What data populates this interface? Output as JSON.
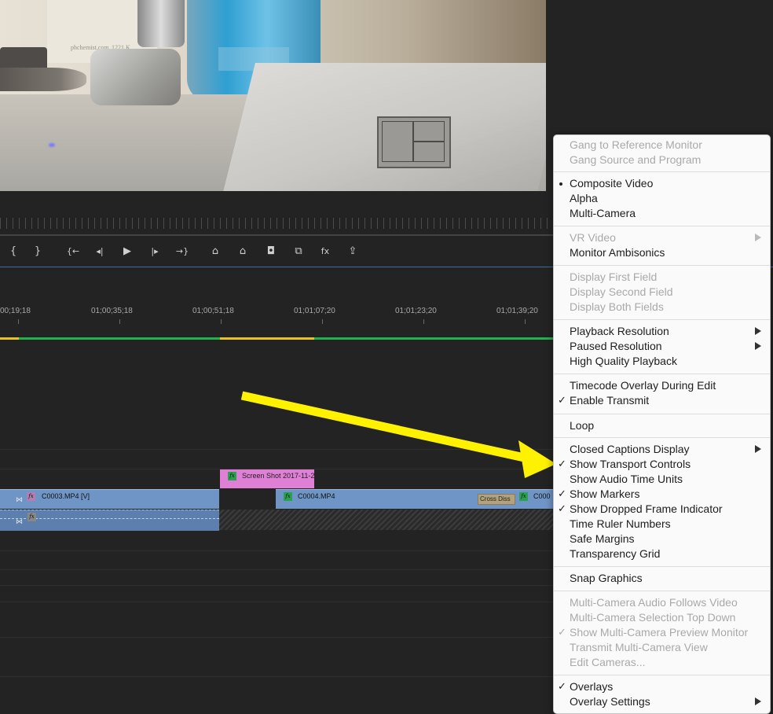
{
  "program_monitor": {
    "card_text_1": "phchemist.com",
    "card_text_2": "1221 K"
  },
  "transport": {
    "buttons": [
      {
        "name": "mark-in-icon",
        "glyph": "{"
      },
      {
        "name": "mark-out-icon",
        "glyph": "}"
      },
      {
        "name": "go-to-in-icon",
        "glyph": "{←"
      },
      {
        "name": "step-back-icon",
        "glyph": "◂|"
      },
      {
        "name": "play-icon",
        "glyph": "▶"
      },
      {
        "name": "step-forward-icon",
        "glyph": "|▸"
      },
      {
        "name": "go-to-out-icon",
        "glyph": "→}"
      },
      {
        "name": "lift-icon",
        "glyph": "⌂"
      },
      {
        "name": "extract-icon",
        "glyph": "⌂"
      },
      {
        "name": "export-frame-icon",
        "glyph": "◘"
      },
      {
        "name": "comparison-view-icon",
        "glyph": "⧉"
      },
      {
        "name": "fx-icon",
        "glyph": "fx"
      },
      {
        "name": "export-icon",
        "glyph": "⇪"
      }
    ]
  },
  "timeline": {
    "timecodes": [
      "00;19;18",
      "01;00;35;18",
      "01;00;51;18",
      "01;01;07;20",
      "01;01;23;20",
      "01;01;39;20"
    ],
    "clips": {
      "v1_clip_a": "C0003.MP4 [V]",
      "v1_clip_b": "C0004.MP4",
      "v1_clip_c": "C000",
      "v2_graphic": "Screen Shot 2017-11-2",
      "transition": "Cross Diss"
    }
  },
  "menu": {
    "groups": [
      [
        {
          "label": "Gang to Reference Monitor",
          "enabled": false
        },
        {
          "label": "Gang Source and Program",
          "enabled": false
        }
      ],
      [
        {
          "label": "Composite Video",
          "enabled": true,
          "mark": "bullet"
        },
        {
          "label": "Alpha",
          "enabled": true
        },
        {
          "label": "Multi-Camera",
          "enabled": true
        }
      ],
      [
        {
          "label": "VR Video",
          "enabled": false,
          "submenu": true
        },
        {
          "label": "Monitor Ambisonics",
          "enabled": true
        }
      ],
      [
        {
          "label": "Display First Field",
          "enabled": false
        },
        {
          "label": "Display Second Field",
          "enabled": false
        },
        {
          "label": "Display Both Fields",
          "enabled": false
        }
      ],
      [
        {
          "label": "Playback Resolution",
          "enabled": true,
          "submenu": true
        },
        {
          "label": "Paused Resolution",
          "enabled": true,
          "submenu": true
        },
        {
          "label": "High Quality Playback",
          "enabled": true
        }
      ],
      [
        {
          "label": "Timecode Overlay During Edit",
          "enabled": true
        },
        {
          "label": "Enable Transmit",
          "enabled": true,
          "mark": "check"
        }
      ],
      [
        {
          "label": "Loop",
          "enabled": true
        }
      ],
      [
        {
          "label": "Closed Captions Display",
          "enabled": true,
          "submenu": true
        },
        {
          "label": "Show Transport Controls",
          "enabled": true,
          "mark": "check"
        },
        {
          "label": "Show Audio Time Units",
          "enabled": true
        },
        {
          "label": "Show Markers",
          "enabled": true,
          "mark": "check"
        },
        {
          "label": "Show Dropped Frame Indicator",
          "enabled": true,
          "mark": "check"
        },
        {
          "label": "Time Ruler Numbers",
          "enabled": true
        },
        {
          "label": "Safe Margins",
          "enabled": true
        },
        {
          "label": "Transparency Grid",
          "enabled": true
        }
      ],
      [
        {
          "label": "Snap Graphics",
          "enabled": true
        }
      ],
      [
        {
          "label": "Multi-Camera Audio Follows Video",
          "enabled": false
        },
        {
          "label": "Multi-Camera Selection Top Down",
          "enabled": false
        },
        {
          "label": "Show Multi-Camera Preview Monitor",
          "enabled": false,
          "mark": "check"
        },
        {
          "label": "Transmit Multi-Camera View",
          "enabled": false
        },
        {
          "label": "Edit Cameras...",
          "enabled": false
        }
      ],
      [
        {
          "label": "Overlays",
          "enabled": true,
          "mark": "check"
        },
        {
          "label": "Overlay Settings",
          "enabled": true,
          "submenu": true
        }
      ]
    ]
  },
  "colors": {
    "annotation_arrow": "#fff200",
    "clip_video": "#6f95c6",
    "clip_graphic": "#e07fd6",
    "work_area": "#22b14c"
  }
}
